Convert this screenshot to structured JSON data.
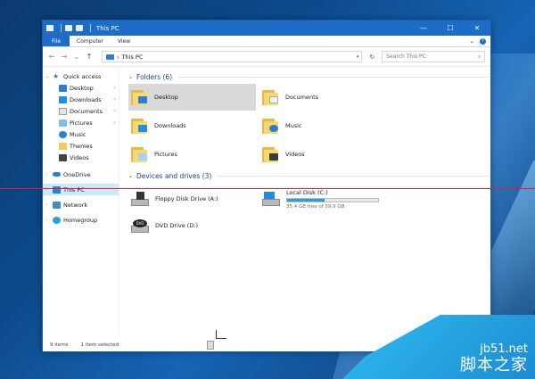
{
  "window": {
    "title": "This PC",
    "controls": {
      "minimize": "—",
      "maximize": "☐",
      "close": "✕"
    }
  },
  "ribbon": {
    "tabs": [
      {
        "label": "File"
      },
      {
        "label": "Computer"
      },
      {
        "label": "View"
      }
    ],
    "expand": "⌄",
    "help": "?"
  },
  "navigation": {
    "back": "←",
    "forward": "→",
    "recent": "⌄",
    "up": "↑",
    "address": "This PC",
    "address_dropdown": "▾",
    "refresh": "↻",
    "search_placeholder": "Search This PC",
    "search_icon": "⌕"
  },
  "sidebar": {
    "items": [
      {
        "label": "Quick access",
        "icon": "star-icon",
        "level": 0,
        "chevron": "⌄"
      },
      {
        "label": "Desktop",
        "icon": "desktop-icon",
        "level": 1,
        "pinned": true
      },
      {
        "label": "Downloads",
        "icon": "downloads-icon",
        "level": 1,
        "pinned": true
      },
      {
        "label": "Documents",
        "icon": "documents-icon",
        "level": 1,
        "pinned": true
      },
      {
        "label": "Pictures",
        "icon": "pictures-icon",
        "level": 1,
        "pinned": true
      },
      {
        "label": "Music",
        "icon": "music-icon",
        "level": 1
      },
      {
        "label": "Themes",
        "icon": "folder-icon",
        "level": 1
      },
      {
        "label": "Videos",
        "icon": "videos-icon",
        "level": 1
      },
      {
        "label": "OneDrive",
        "icon": "cloud-icon",
        "level": 0,
        "chevron": "›"
      },
      {
        "label": "This PC",
        "icon": "pc-icon",
        "level": 0,
        "chevron": "›",
        "selected": true
      },
      {
        "label": "Network",
        "icon": "network-icon",
        "level": 0,
        "chevron": "›"
      },
      {
        "label": "Homegroup",
        "icon": "homegroup-icon",
        "level": 0,
        "chevron": "›"
      }
    ],
    "pin_glyph": "✓"
  },
  "content": {
    "folders_header": "Folders (6)",
    "folders": [
      {
        "label": "Desktop",
        "badge_color": "#2a7fd4",
        "selected": true
      },
      {
        "label": "Documents",
        "badge_color": "#f1f1f1"
      },
      {
        "label": "Downloads",
        "badge_color": "#1f8fe0"
      },
      {
        "label": "Music",
        "badge_color": "#2a7fd4"
      },
      {
        "label": "Pictures",
        "badge_color": "#a6d3f2"
      },
      {
        "label": "Videos",
        "badge_color": "#3a3a3a"
      }
    ],
    "drives_header": "Devices and drives (3)",
    "drives": [
      {
        "label": "Floppy Disk Drive (A:)",
        "type": "floppy"
      },
      {
        "label": "Local Disk (C:)",
        "type": "hdd",
        "used_fraction": 0.41,
        "free_text": "35.4 GB free of 59.9 GB"
      },
      {
        "label": "DVD Drive (D:)",
        "type": "dvd",
        "badge": "DVD"
      }
    ],
    "section_chevron": "⌄"
  },
  "status": {
    "items": "9 items",
    "selected": "1 item selected"
  },
  "watermark": {
    "site": "jb51.net",
    "name": "脚本之家"
  },
  "colors": {
    "accent": "#1d6cc7",
    "selection": "#cce8ff",
    "bar": "#26a0da"
  }
}
